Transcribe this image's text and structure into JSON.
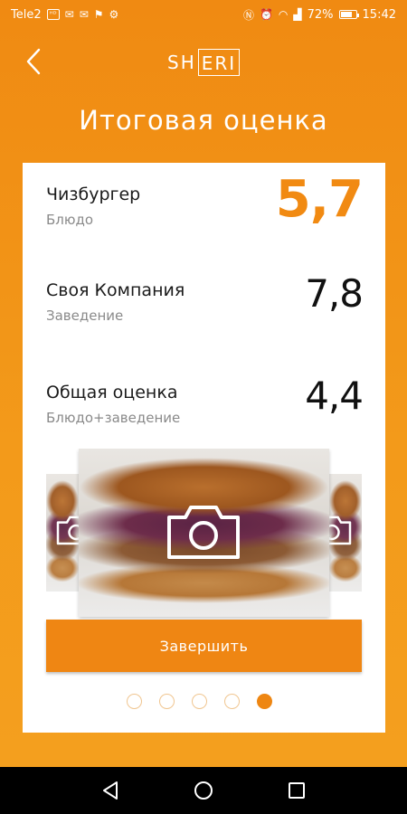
{
  "status_bar": {
    "carrier": "Tele2",
    "battery_percent": "72%",
    "time": "15:42",
    "battery_level": 0.72
  },
  "header": {
    "logo_text_plain": "SH",
    "logo_text_boxed": "ERI"
  },
  "page": {
    "title": "Итоговая оценка"
  },
  "scores": [
    {
      "name": "Чизбургер",
      "sub": "Блюдо",
      "value": "5,7"
    },
    {
      "name": "Своя Компания",
      "sub": "Заведение",
      "value": "7,8"
    },
    {
      "name": "Общая оценка",
      "sub": "Блюдо+заведение",
      "value": "4,4"
    }
  ],
  "actions": {
    "finish_label": "Завершить"
  },
  "pagination": {
    "total": 5,
    "active_index": 4
  },
  "colors": {
    "accent": "#ef8613",
    "background_top": "#f08a12",
    "background_bottom": "#f4a01f",
    "text_dark": "#111111",
    "text_muted": "#8a8a8a"
  }
}
